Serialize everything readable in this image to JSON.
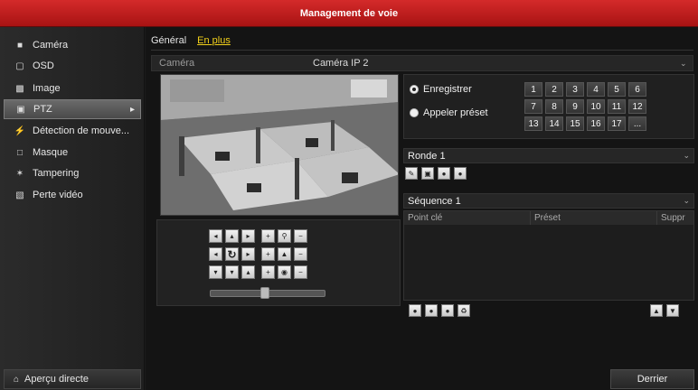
{
  "window": {
    "title": "Management de voie"
  },
  "sidebar": {
    "items": [
      {
        "label": "Caméra",
        "icon": "camera-icon"
      },
      {
        "label": "OSD",
        "icon": "osd-icon"
      },
      {
        "label": "Image",
        "icon": "image-icon"
      },
      {
        "label": "PTZ",
        "icon": "ptz-icon",
        "active": true
      },
      {
        "label": "Détection de mouve...",
        "icon": "motion-detection-icon"
      },
      {
        "label": "Masque",
        "icon": "mask-icon"
      },
      {
        "label": "Tampering",
        "icon": "tampering-icon"
      },
      {
        "label": "Perte vidéo",
        "icon": "video-loss-icon"
      }
    ],
    "live_view": "Aperçu directe"
  },
  "tabs": [
    {
      "label": "Général",
      "active": false
    },
    {
      "label": "En plus",
      "active": true
    }
  ],
  "camera": {
    "label": "Caméra",
    "value": "Caméra IP 2"
  },
  "preset": {
    "record_label": "Enregistrer",
    "call_label": "Appeler préset",
    "numbers": [
      "1",
      "2",
      "3",
      "4",
      "5",
      "6",
      "7",
      "8",
      "9",
      "10",
      "11",
      "12",
      "13",
      "14",
      "15",
      "16",
      "17",
      "..."
    ]
  },
  "patrol": {
    "value": "Ronde 1"
  },
  "sequence": {
    "value": "Séquence 1",
    "columns": [
      "Point clé",
      "Préset",
      "Suppr"
    ]
  },
  "back_button": "Derrier",
  "colors": {
    "title_bar": "#c01c1c",
    "active_tab": "#f3d11a",
    "background": "#141414"
  }
}
